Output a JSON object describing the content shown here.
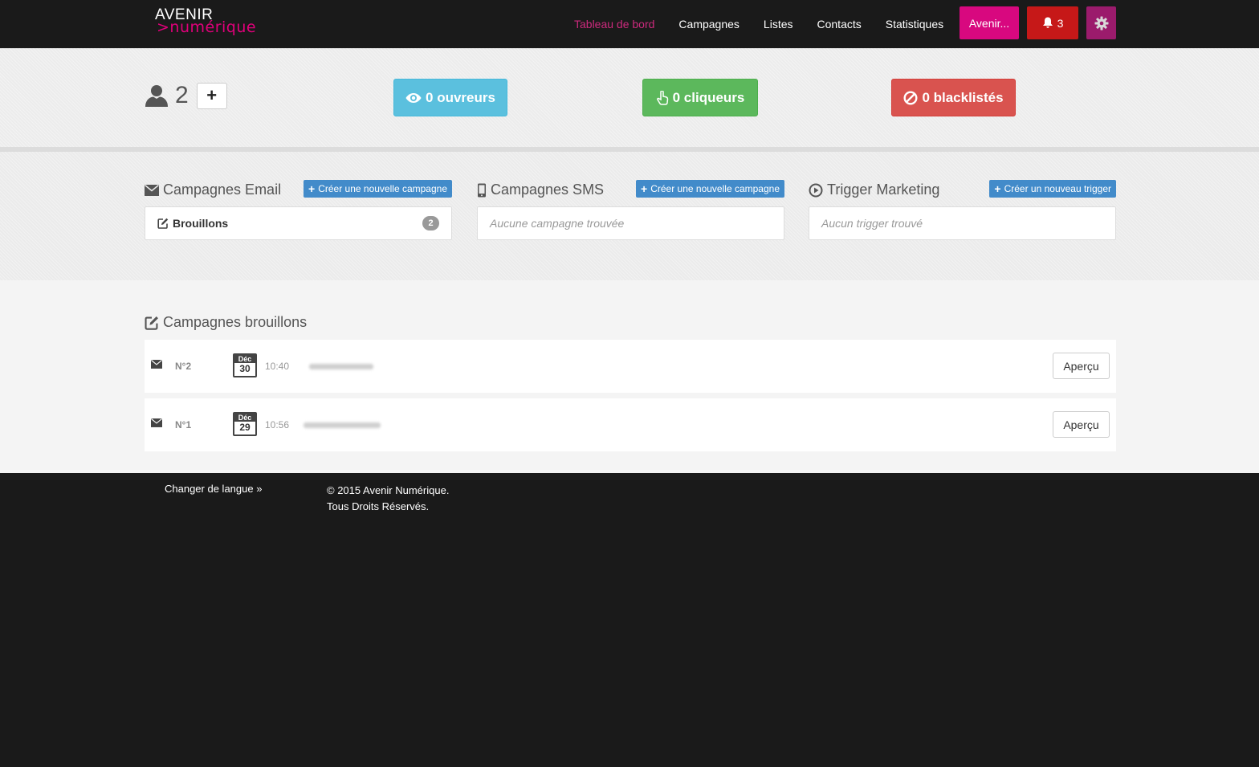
{
  "brand": {
    "line1": "AVENIR",
    "line2": ">numérique"
  },
  "nav": {
    "items": [
      {
        "label": "Tableau de bord",
        "active": true
      },
      {
        "label": "Campagnes"
      },
      {
        "label": "Listes"
      },
      {
        "label": "Contacts"
      },
      {
        "label": "Statistiques"
      }
    ],
    "account_label": "Avenir...",
    "notifications_count": "3"
  },
  "stats": {
    "users_count": "2",
    "add_label": "+",
    "openers": "0 ouvreurs",
    "clickers": "0 cliqueurs",
    "blacklisted": "0 blacklistés"
  },
  "campaigns": {
    "email": {
      "title": "Campagnes Email",
      "create_label": "Créer une nouvelle campagne",
      "draft_label": "Brouillons",
      "draft_count": "2"
    },
    "sms": {
      "title": "Campagnes SMS",
      "create_label": "Créer une nouvelle campagne",
      "empty_text": "Aucune campagne trouvée"
    },
    "trigger": {
      "title": "Trigger Marketing",
      "create_label": "Créer un nouveau trigger",
      "empty_text": "Aucun trigger trouvé"
    }
  },
  "drafts": {
    "title": "Campagnes brouillons",
    "rows": [
      {
        "number": "N°2",
        "month": "Déc",
        "day": "30",
        "time": "10:40",
        "action": "Aperçu"
      },
      {
        "number": "N°1",
        "month": "Déc",
        "day": "29",
        "time": "10:56",
        "action": "Aperçu"
      }
    ]
  },
  "footer": {
    "language_link": "Changer de langue »",
    "copyright_line1": "© 2015 Avenir Numérique.",
    "copyright_line2": "Tous Droits Réservés."
  },
  "colors": {
    "brand_pink": "#d8087f",
    "danger": "#c61818",
    "info": "#5bc0de",
    "success": "#5cb85c",
    "blacklist": "#d9534f",
    "primary": "#428bca"
  }
}
